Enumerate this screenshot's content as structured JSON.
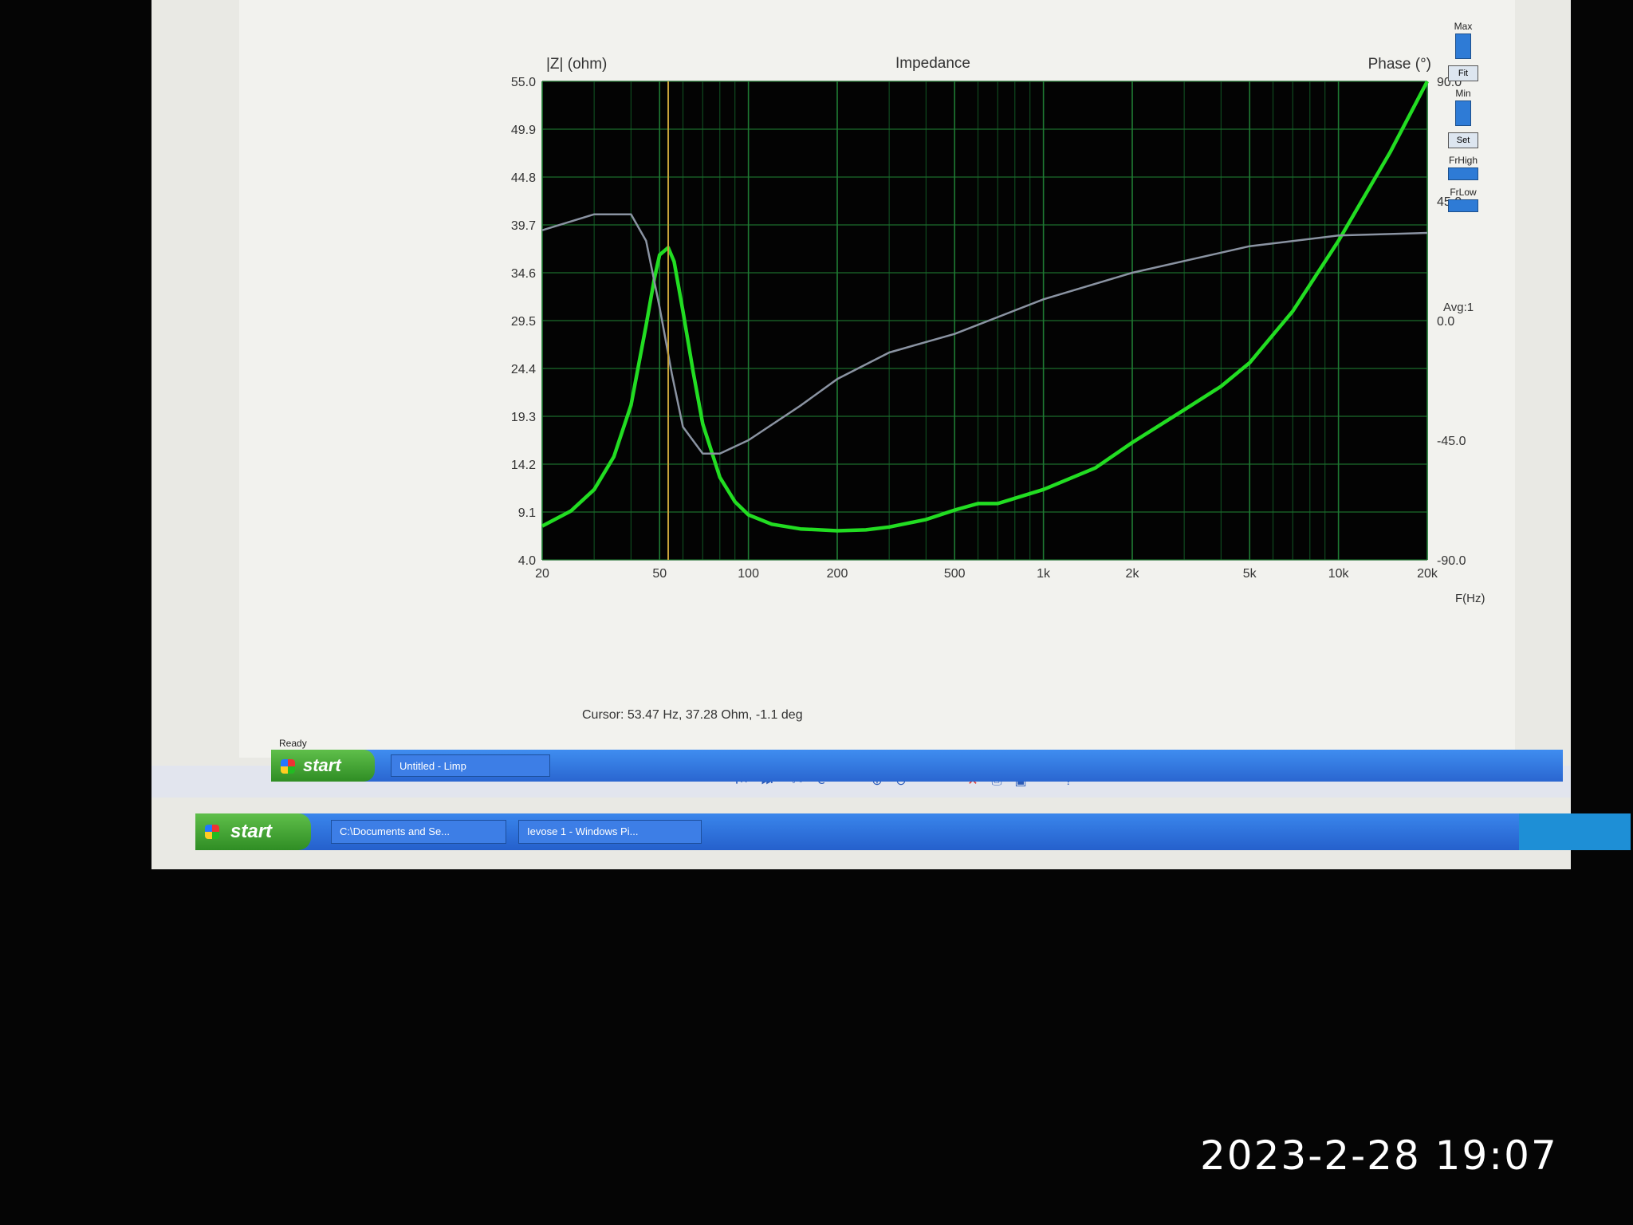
{
  "chart_data": {
    "type": "line",
    "title": "Impedance",
    "xlabel": "F(Hz)",
    "ylabel": "|Z| (ohm)",
    "y2label": "Phase (°)",
    "x_scale": "log",
    "xlim": [
      20,
      20000
    ],
    "ylim": [
      4.0,
      55.0
    ],
    "y2lim": [
      -90.0,
      90.0
    ],
    "x_ticks": [
      "20",
      "50",
      "100",
      "200",
      "500",
      "1k",
      "2k",
      "5k",
      "10k",
      "20k"
    ],
    "x_tick_values": [
      20,
      50,
      100,
      200,
      500,
      1000,
      2000,
      5000,
      10000,
      20000
    ],
    "y_ticks": [
      "55.0",
      "49.9",
      "44.8",
      "39.7",
      "34.6",
      "29.5",
      "24.4",
      "19.3",
      "14.2",
      "9.1",
      "4.0"
    ],
    "y2_ticks": [
      "90.0",
      "45.0",
      "0.0",
      "-45.0",
      "-90.0"
    ],
    "grid": true,
    "cursor_x": 53.47,
    "series": [
      {
        "color": "#22dd22",
        "x": [
          20,
          25,
          30,
          35,
          40,
          45,
          48,
          50,
          53.47,
          56,
          60,
          65,
          70,
          80,
          90,
          100,
          120,
          150,
          200,
          250,
          300,
          400,
          500,
          600,
          700,
          1000,
          1500,
          2000,
          3000,
          4000,
          5000,
          7000,
          10000,
          15000,
          20000
        ],
        "y": [
          7.6,
          9.2,
          11.5,
          15.0,
          20.5,
          29.0,
          34.0,
          36.5,
          37.28,
          35.8,
          30.5,
          24.0,
          18.5,
          12.8,
          10.2,
          8.8,
          7.8,
          7.3,
          7.1,
          7.2,
          7.5,
          8.3,
          9.3,
          10.0,
          10.0,
          11.5,
          13.8,
          16.5,
          20.0,
          22.5,
          25.0,
          30.5,
          38.0,
          47.5,
          55.0
        ]
      },
      {
        "color": "#8a93a2",
        "axis": "y2",
        "x": [
          20,
          30,
          40,
          45,
          50,
          55,
          60,
          70,
          80,
          100,
          150,
          200,
          300,
          500,
          1000,
          2000,
          5000,
          10000,
          20000
        ],
        "y": [
          34,
          40,
          40,
          30,
          5,
          -20,
          -40,
          -50,
          -50,
          -45,
          -32,
          -22,
          -12,
          -5,
          8,
          18,
          28,
          32,
          33
        ]
      }
    ]
  },
  "chart_text": {
    "cursor": "Cursor: 53.47 Hz, 37.28 Ohm, -1.1 deg",
    "avg": "Avg:1"
  },
  "side_panel": {
    "max_label": "Max",
    "fit_label": "Fit",
    "min_label": "Min",
    "set_label": "Set",
    "frhigh_label": "FrHigh",
    "frlow_label": "FrLow"
  },
  "status": {
    "ready": "Ready"
  },
  "inner_taskbar": {
    "start_label": "start",
    "task1": "Untitled - Limp"
  },
  "outer_taskbar": {
    "start_label": "start",
    "task1": "C:\\Documents and Se...",
    "task2": "Ievose 1 - Windows Pi..."
  },
  "timestamp": "2023-2-28 19:07"
}
